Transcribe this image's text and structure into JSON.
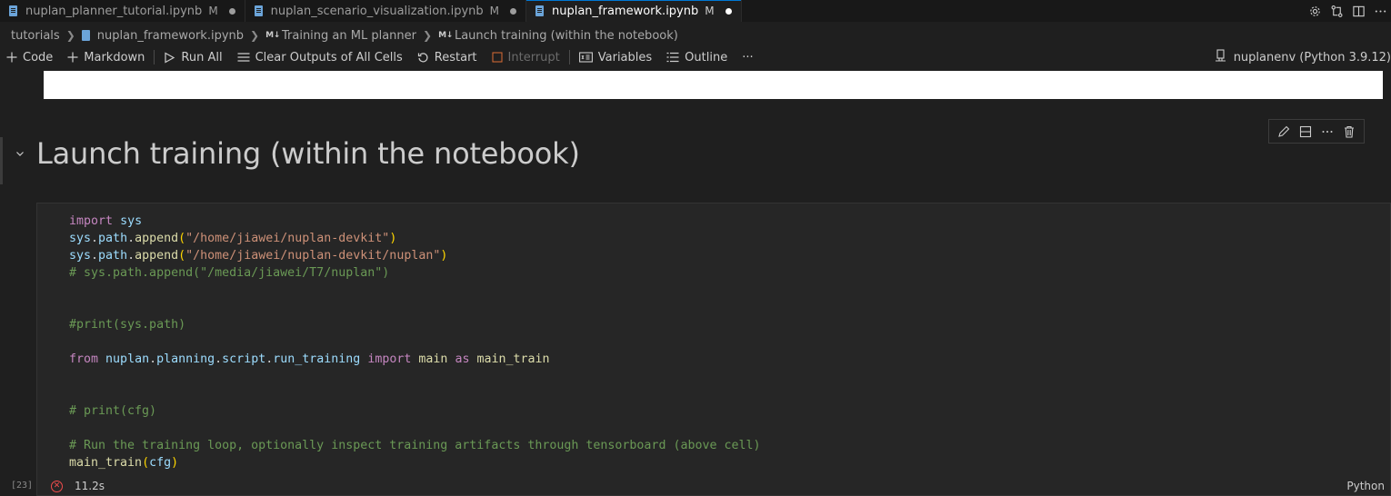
{
  "tabs": [
    {
      "label": "nuplan_planner_tutorial.ipynb",
      "status": "M",
      "active": false
    },
    {
      "label": "nuplan_scenario_visualization.ipynb",
      "status": "M",
      "active": false
    },
    {
      "label": "nuplan_framework.ipynb",
      "status": "M",
      "active": true
    }
  ],
  "tab_actions": [
    "settings-icon",
    "compare-icon",
    "split-editor-icon",
    "more-icon"
  ],
  "breadcrumb": {
    "folder": "tutorials",
    "file": "nuplan_framework.ipynb",
    "section_badge": "M↓",
    "section": "Training an ML planner",
    "subsection_badge": "M↓",
    "subsection": "Launch training (within the notebook)"
  },
  "toolbar": {
    "code": "Code",
    "markdown": "Markdown",
    "run_all": "Run All",
    "clear_outputs": "Clear Outputs of All Cells",
    "restart": "Restart",
    "interrupt": "Interrupt",
    "variables": "Variables",
    "outline": "Outline",
    "more": "···"
  },
  "kernel": {
    "label": "nuplanenv (Python 3.9.12)"
  },
  "markdown_cell": {
    "heading": "Launch training (within the notebook)"
  },
  "cell_toolbar": [
    "edit-icon",
    "split-cell-icon",
    "more-icon",
    "delete-icon"
  ],
  "code_cell": {
    "execution_count": "[23]",
    "exec_time": "11.2s",
    "language": "Python",
    "lines": [
      [
        {
          "t": "import",
          "c": "kw"
        },
        {
          "t": " "
        },
        {
          "t": "sys",
          "c": "var"
        }
      ],
      [
        {
          "t": "sys",
          "c": "var"
        },
        {
          "t": "."
        },
        {
          "t": "path",
          "c": "var"
        },
        {
          "t": "."
        },
        {
          "t": "append",
          "c": "fn"
        },
        {
          "t": "(",
          "c": "par"
        },
        {
          "t": "\"/home/jiawei/nuplan-devkit\"",
          "c": "str"
        },
        {
          "t": ")",
          "c": "par"
        }
      ],
      [
        {
          "t": "sys",
          "c": "var"
        },
        {
          "t": "."
        },
        {
          "t": "path",
          "c": "var"
        },
        {
          "t": "."
        },
        {
          "t": "append",
          "c": "fn"
        },
        {
          "t": "(",
          "c": "par"
        },
        {
          "t": "\"/home/jiawei/nuplan-devkit/nuplan\"",
          "c": "str"
        },
        {
          "t": ")",
          "c": "par"
        }
      ],
      [
        {
          "t": "# sys.path.append(\"/media/jiawei/T7/nuplan\")",
          "c": "cm"
        }
      ],
      [],
      [],
      [
        {
          "t": "#print(sys.path)",
          "c": "cm"
        }
      ],
      [],
      [
        {
          "t": "from",
          "c": "kw"
        },
        {
          "t": " "
        },
        {
          "t": "nuplan",
          "c": "var"
        },
        {
          "t": "."
        },
        {
          "t": "planning",
          "c": "var"
        },
        {
          "t": "."
        },
        {
          "t": "script",
          "c": "var"
        },
        {
          "t": "."
        },
        {
          "t": "run_training",
          "c": "var"
        },
        {
          "t": " "
        },
        {
          "t": "import",
          "c": "kw"
        },
        {
          "t": " "
        },
        {
          "t": "main",
          "c": "fn"
        },
        {
          "t": " "
        },
        {
          "t": "as",
          "c": "kw"
        },
        {
          "t": " "
        },
        {
          "t": "main_train",
          "c": "fn"
        }
      ],
      [],
      [],
      [
        {
          "t": "# print(cfg)",
          "c": "cm"
        }
      ],
      [],
      [
        {
          "t": "# Run the training loop, optionally inspect training artifacts through tensorboard (above cell)",
          "c": "cm"
        }
      ],
      [
        {
          "t": "main_train",
          "c": "fn"
        },
        {
          "t": "(",
          "c": "par"
        },
        {
          "t": "cfg",
          "c": "var"
        },
        {
          "t": ")",
          "c": "par"
        }
      ]
    ]
  },
  "colors": {
    "accent": "#0078d4",
    "error": "#f14c4c",
    "editor_bg": "#1f1f1f",
    "cell_bg": "#262626"
  }
}
